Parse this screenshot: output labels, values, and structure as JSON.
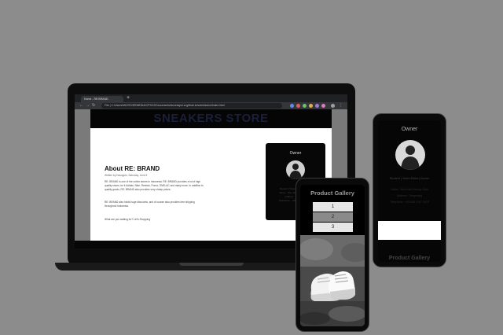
{
  "browser": {
    "tab_title": "Home - RE:BRAND",
    "new_tab": "+",
    "url": "File | C:/Users/MICRO/ERMEDIA/CPSC2/Documents/Accesspoi.w.github.io/submission/index.html"
  },
  "site": {
    "title": "SNEAKERS STORE",
    "about": {
      "heading": "About RE: BRAND",
      "byline": "Written by Hasugolo, Saturday, June 8",
      "paragraphs": [
        "RE: BRAND is one of the online stores in Indonesia. RE: BRAND provides a lot of high quality shoes, be it Adidas, Nike, Reebok, Puma, ONELAC and many more. In addition to quality goods, RE: BRAND also provides very cheap prices.",
        "RE: BRAND also holds huge discounts, and of course also provides free shipping throughout Indonesia.",
        "What are you waiting for? Let's Shopping"
      ]
    },
    "owner_card": {
      "heading": "Owner",
      "lines": [
        "Student | Video Editor | Gamer",
        "Name : Nico Aldo Hendrie Sani",
        "Address : Tangerang",
        "Telephone : +62 891 5747 2478"
      ]
    }
  },
  "phone_right": {
    "owner_heading": "Owner",
    "role": "Student | Video Editor| Gamer",
    "info": [
      "Name : Nico Aldo Hendry Sani",
      "Address : Tangerang",
      "Telephone : +62 895 1747 2478"
    ],
    "gallery_heading": "Product Gallery"
  },
  "phone_front": {
    "gallery_heading": "Product Gallery",
    "buttons": [
      "1",
      "2",
      "3"
    ]
  },
  "colors": {
    "backdrop": "#8c8c8c",
    "device_frame": "#0d0d0d",
    "header_text": "#1a1f3a"
  }
}
